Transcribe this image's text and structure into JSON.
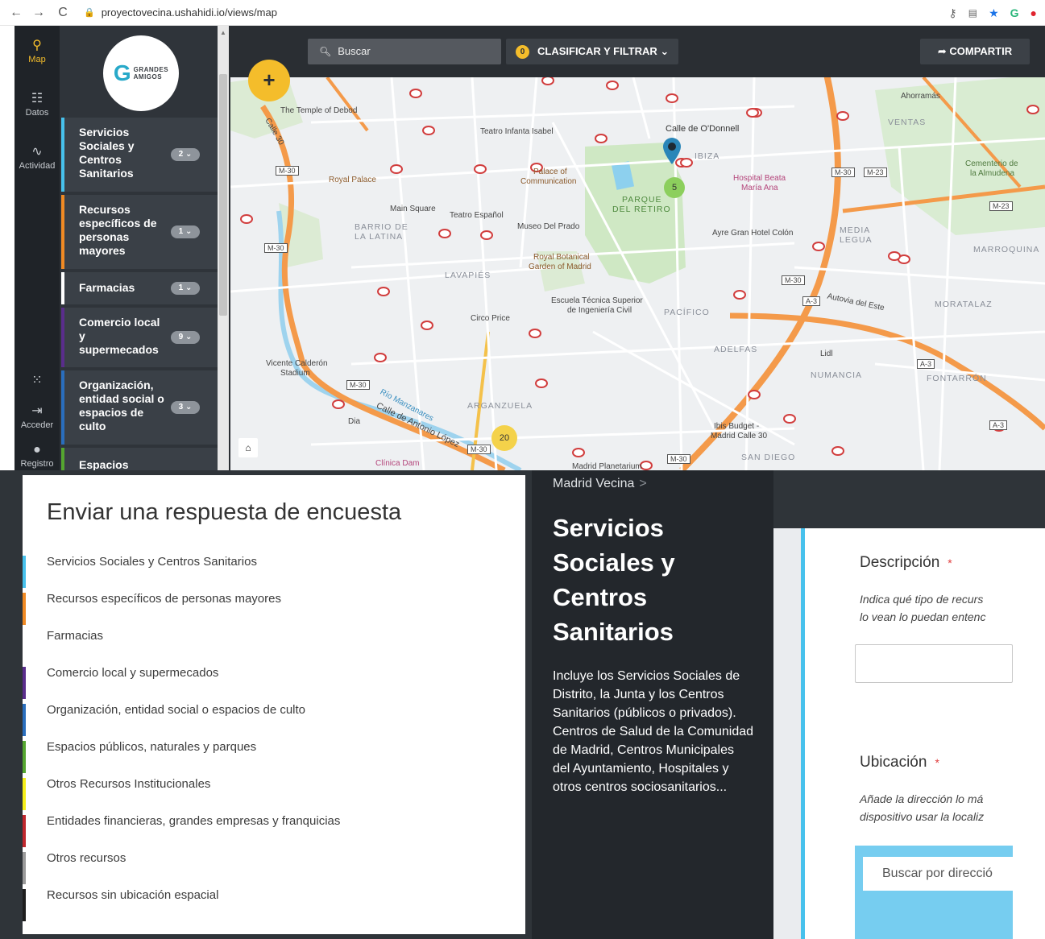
{
  "browser": {
    "back": "←",
    "forward": "→",
    "reload": "C",
    "lock": "🔒",
    "url": "proyectovecina.ushahidi.io/views/map"
  },
  "leftnav": {
    "map": "Map",
    "datos": "Datos",
    "actividad": "Actividad",
    "acceder": "Acceder",
    "registro": "Registro"
  },
  "logo": {
    "text_line1": "GRANDES",
    "text_line2": "AMIGOS"
  },
  "categories": [
    {
      "label": "Servicios Sociales y Centros Sanitarios",
      "count": "2",
      "color": "#47c1ec"
    },
    {
      "label": "Recursos específicos de personas mayores",
      "count": "1",
      "color": "#f08a24"
    },
    {
      "label": "Farmacias",
      "count": "1",
      "color": "#ffffff"
    },
    {
      "label": "Comercio local y supermecados",
      "count": "9",
      "color": "#5a2d8c"
    },
    {
      "label": "Organización, entidad social o espacios de culto",
      "count": "3",
      "color": "#2a6ebd"
    },
    {
      "label": "Espacios",
      "count": "",
      "color": "#55a630"
    }
  ],
  "map": {
    "search_placeholder": "Buscar",
    "filter_label": "CLASIFICAR Y FILTRAR",
    "filter_count": "0",
    "share_label": "COMPARTIR",
    "add_label": "+",
    "home_label": "⌂",
    "clusters": [
      "5",
      "20"
    ],
    "places": {
      "temple": "The Temple of Debod",
      "teatro_infanta": "Teatro Infanta Isabel",
      "odonnell": "Calle de O'Donnell",
      "ibiza": "IBIZA",
      "ahorramas": "Ahorramás",
      "ventas": "VENTAS",
      "royal_palace": "Royal Palace",
      "palace_comm_1": "Palace of",
      "palace_comm_2": "Communication",
      "parque_1": "PARQUE",
      "parque_2": "DEL RETIRO",
      "hospital_1": "Hospital Beata",
      "hospital_2": "María Ana",
      "cementerio_1": "Cementerio de",
      "cementerio_2": "la Almudena",
      "main_square": "Main Square",
      "teatro_esp": "Teatro Español",
      "barrio_1": "BARRIO DE",
      "barrio_2": "LA LATINA",
      "museo": "Museo Del Prado",
      "ayre": "Ayre Gran Hotel Colón",
      "media_1": "MEDIA",
      "media_2": "LEGUA",
      "marroquina": "MARROQUINA",
      "botanical_1": "Royal Botanical",
      "botanical_2": "Garden of Madrid",
      "lavapies": "LAVAPIÉS",
      "escuela_1": "Escuela Técnica Superior",
      "escuela_2": "de Ingeniería Civil",
      "pacifico": "PACÍFICO",
      "autovia": "Autovia del Este",
      "moratalaz": "MORATALAZ",
      "circo": "Circo Price",
      "adelfas": "ADELFAS",
      "lidl": "Lidl",
      "numancia": "NUMANCIA",
      "fontarron": "FONTARRÓN",
      "vicente_1": "Vicente Calderón",
      "vicente_2": "Stadium",
      "arganzuela": "ARGANZUELA",
      "dia": "Dia",
      "antonio_lopez": "Calle de Antonio López",
      "rio": "Río Manzanares",
      "ibis_1": "Ibis Budget -",
      "ibis_2": "Madrid Calle 30",
      "san_diego": "SAN DIEGO",
      "clinica": "Clínica Dam",
      "planetarium": "Madrid Planetarium",
      "calle30": "Calle 30"
    },
    "roads": [
      "M-30",
      "M-23",
      "A-3"
    ]
  },
  "modal": {
    "title": "Enviar una respuesta de encuesta",
    "items": [
      {
        "label": "Servicios Sociales y Centros Sanitarios",
        "color": "#47c1ec"
      },
      {
        "label": "Recursos específicos de personas mayores",
        "color": "#f08a24"
      },
      {
        "label": "Farmacias",
        "color": "#ffffff"
      },
      {
        "label": "Comercio local y supermecados",
        "color": "#5a2d8c"
      },
      {
        "label": "Organización, entidad social o espacios de culto",
        "color": "#2a6ebd"
      },
      {
        "label": "Espacios públicos, naturales y parques",
        "color": "#55a630"
      },
      {
        "label": "Otros Recursos Institucionales",
        "color": "#f6ef1a"
      },
      {
        "label": "Entidades financieras, grandes empresas y franquicias",
        "color": "#c0272d"
      },
      {
        "label": "Otros recursos",
        "color": "#9a9a9a"
      },
      {
        "label": "Recursos sin ubicación espacial",
        "color": "#1e1e1e"
      }
    ]
  },
  "form": {
    "breadcrumb": "Madrid Vecina",
    "breadcrumb_sep": ">",
    "title": "Servicios Sociales y Centros Sanitarios",
    "description": "Incluye los Servicios Sociales de Distrito, la Junta y los Centros Sanitarios (públicos o privados). Centros de Salud de la Comunidad de Madrid, Centros Municipales del Ayuntamiento, Hospitales y otros centros sociosanitarios...",
    "desc_label": "Descripción",
    "required_mark": "*",
    "desc_hint_1": "Indica qué tipo de recurs",
    "desc_hint_2": "lo vean lo puedan entenc",
    "loc_label": "Ubicación",
    "loc_hint_1": "Añade la dirección lo má",
    "loc_hint_2": "dispositivo usar la localiz",
    "address_placeholder": "Buscar por direcció"
  }
}
